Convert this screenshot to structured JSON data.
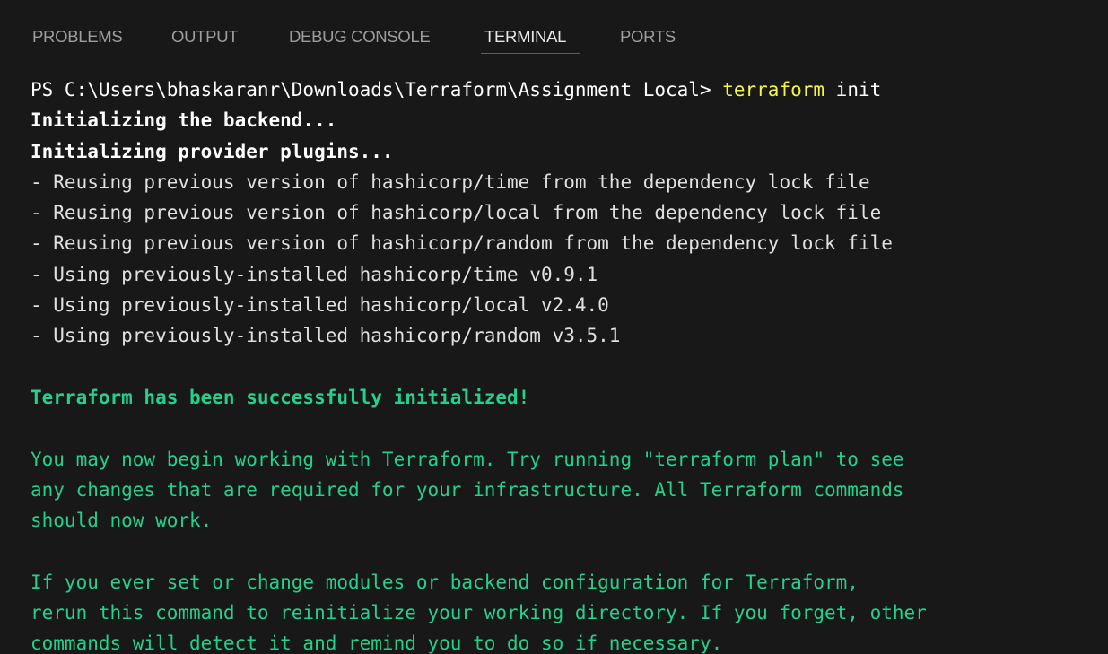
{
  "tabs": [
    {
      "label": "PROBLEMS",
      "active": false
    },
    {
      "label": "OUTPUT",
      "active": false
    },
    {
      "label": "DEBUG CONSOLE",
      "active": false
    },
    {
      "label": "TERMINAL",
      "active": true
    },
    {
      "label": "PORTS",
      "active": false
    }
  ],
  "terminal": {
    "prompt": "PS C:\\Users\\bhaskaranr\\Downloads\\Terraform\\Assignment_Local> ",
    "command": "terraform",
    "command_args": " init",
    "lines": [
      "Initializing the backend...",
      "Initializing provider plugins...",
      "- Reusing previous version of hashicorp/time from the dependency lock file",
      "- Reusing previous version of hashicorp/local from the dependency lock file",
      "- Reusing previous version of hashicorp/random from the dependency lock file",
      "- Using previously-installed hashicorp/time v0.9.1",
      "- Using previously-installed hashicorp/local v2.4.0",
      "- Using previously-installed hashicorp/random v3.5.1",
      "",
      "Terraform has been successfully initialized!",
      "",
      "You may now begin working with Terraform. Try running \"terraform plan\" to see",
      "any changes that are required for your infrastructure. All Terraform commands",
      "should now work.",
      "",
      "If you ever set or change modules or backend configuration for Terraform,",
      "rerun this command to reinitialize your working directory. If you forget, other",
      "commands will detect it and remind you to do so if necessary."
    ]
  },
  "colors": {
    "background": "#181818",
    "text": "#e0e0e0",
    "success_green": "#23d18b",
    "command_yellow": "#f5f543",
    "tab_active_underline": "#0078d4"
  }
}
